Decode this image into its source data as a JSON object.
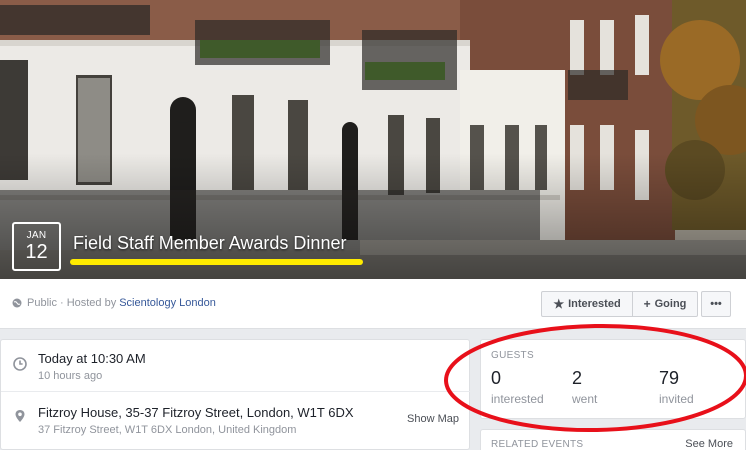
{
  "cover": {
    "date_month": "JAN",
    "date_day": "12",
    "title": "Field Staff Member Awards Dinner"
  },
  "info_bar": {
    "privacy": "Public",
    "hosted_prefix": "· Hosted by",
    "host_name": "Scientology London",
    "interested_label": "Interested",
    "going_label": "Going",
    "more_label": "•••"
  },
  "details": {
    "time_primary": "Today at 10:30 AM",
    "time_secondary": "10 hours ago",
    "place_primary": "Fitzroy House, 35-37 Fitzroy Street, London, W1T 6DX",
    "place_secondary": "37 Fitzroy Street, W1T 6DX London, United Kingdom",
    "show_map_label": "Show Map"
  },
  "guests": {
    "header": "GUESTS",
    "stats": [
      {
        "count": "0",
        "label": "interested"
      },
      {
        "count": "2",
        "label": "went"
      },
      {
        "count": "79",
        "label": "invited"
      }
    ]
  },
  "related": {
    "header": "RELATED EVENTS",
    "see_more": "See More"
  },
  "colors": {
    "facebook_link": "#365899",
    "annotation_red": "#e8101a",
    "annotation_yellow": "#ffeb00",
    "background": "#e9ebee"
  }
}
